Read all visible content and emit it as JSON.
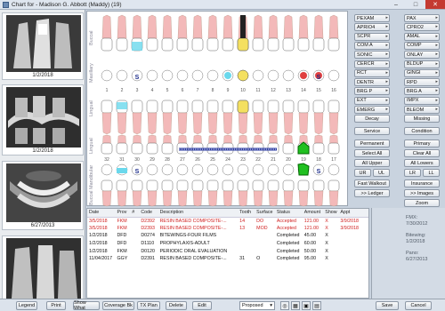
{
  "window": {
    "title": "Chart for - Madison G. Abbott (Maddy) (19)",
    "min": "–",
    "max": "□",
    "close": "✕"
  },
  "sidebar": {
    "cards": [
      {
        "date": "1/2/2018"
      },
      {
        "date": "1/2/2018"
      },
      {
        "date": "6/27/2013"
      },
      {
        "date": ""
      }
    ]
  },
  "chart": {
    "row_labels": [
      "Buccal",
      "Maxillary",
      "Lingual",
      "Lingual",
      "Mandibular",
      "Buccal"
    ],
    "upper_numbers": [
      "1",
      "2",
      "3",
      "4",
      "5",
      "6",
      "7",
      "8",
      "9",
      "10",
      "11",
      "12",
      "13",
      "14",
      "15",
      "16"
    ],
    "lower_numbers": [
      "32",
      "31",
      "30",
      "29",
      "28",
      "27",
      "26",
      "25",
      "24",
      "23",
      "22",
      "21",
      "20",
      "19",
      "18",
      "17"
    ],
    "sealant_marks": [
      "S",
      "S",
      "S",
      "S"
    ]
  },
  "panel": {
    "left": [
      "PEXAM",
      "APRIO4",
      "SCPR",
      "COM A",
      "SONIC",
      "CERCR",
      "RCT",
      "DENTR",
      "BRG P",
      "EXT",
      "EMERG"
    ],
    "right": [
      "PAX",
      "CPRO2",
      "AMAL",
      "COMP",
      "ONLAY",
      "BLDUP",
      "GINGI",
      "RPD",
      "BRG A",
      "IMPX",
      "BLEOM"
    ],
    "decay": "Decay",
    "missing": "Missing",
    "service": "Service",
    "condition": "Condition",
    "permanent": "Permanent",
    "primary": "Primary",
    "select_all": "Select All",
    "clear_all": "Clear All",
    "all_upper": "All Upper",
    "all_lower": "All Lowers",
    "ur": "UR",
    "ul": "UL",
    "lr": "LR",
    "ll": "LL",
    "fast_walkout": "Fast Walkout",
    "insurance": "Insurance",
    "ledger": ">> Ledger",
    "images": ">> Images",
    "zoom": "Zoom"
  },
  "table": {
    "headers": [
      "Date",
      "Prov",
      "#",
      "Code",
      "Description",
      "Tooth",
      "Surface",
      "Status",
      "Amount",
      "Show",
      "Appt"
    ],
    "rows": [
      {
        "date": "3/5/2018",
        "prov": "FKM",
        "num": "",
        "code": "D2392",
        "desc": "RESIN BASED COMPOSITE-...",
        "tooth": "14",
        "surface": "DO",
        "status": "Accepted",
        "amount": "121.00",
        "show": "X",
        "appt": "3/9/2018",
        "red": true
      },
      {
        "date": "3/5/2018",
        "prov": "FKM",
        "num": "",
        "code": "D2393",
        "desc": "RESIN BASED COMPOSITE-...",
        "tooth": "13",
        "surface": "MOD",
        "status": "Accepted",
        "amount": "121.00",
        "show": "X",
        "appt": "3/9/2018",
        "red": true
      },
      {
        "date": "1/2/2018",
        "prov": "DFD",
        "num": "",
        "code": "D0274",
        "desc": "BITEWINGS-FOUR FILMS",
        "tooth": "",
        "surface": "",
        "status": "Completed",
        "amount": "45.00",
        "show": "X",
        "appt": "",
        "red": false
      },
      {
        "date": "1/2/2018",
        "prov": "DFD",
        "num": "",
        "code": "D1110",
        "desc": "PROPHYLAXIS-ADULT",
        "tooth": "",
        "surface": "",
        "status": "Completed",
        "amount": "60.00",
        "show": "X",
        "appt": "",
        "red": false
      },
      {
        "date": "1/2/2018",
        "prov": "FKM",
        "num": "",
        "code": "D0120",
        "desc": "PERIODIC ORAL EVALUATION",
        "tooth": "",
        "surface": "",
        "status": "Completed",
        "amount": "50.00",
        "show": "X",
        "appt": "",
        "red": false
      },
      {
        "date": "11/04/2017",
        "prov": "GGY",
        "num": "",
        "code": "D2391",
        "desc": "RESIN BASED COMPOSITE-...",
        "tooth": "31",
        "surface": "O",
        "status": "Completed",
        "amount": "95.00",
        "show": "X",
        "appt": "",
        "red": false
      }
    ]
  },
  "info": {
    "fmx_label": "FMX:",
    "fmx_date": "7/30/2012",
    "bitewing_label": "Bitewing:",
    "bitewing_date": "1/2/2018",
    "pano_label": "Pano:",
    "pano_date": "6/27/2013"
  },
  "bottom": {
    "legend": "Legend",
    "print": "Print",
    "show_what": "Show What",
    "coverage_bk": "Coverage Bk",
    "tx_plan": "TX Plan",
    "delete": "Delete",
    "edit": "Edit",
    "status_value": "Proposed",
    "save": "Save",
    "cancel": "Cancel"
  },
  "colors": {
    "root_pink": "#f3b9b9",
    "green": "#20c020",
    "yellow": "#f4e060",
    "cyan": "#6ad8ec",
    "bridge": "#2a3aa0",
    "red_text": "#d02020"
  }
}
